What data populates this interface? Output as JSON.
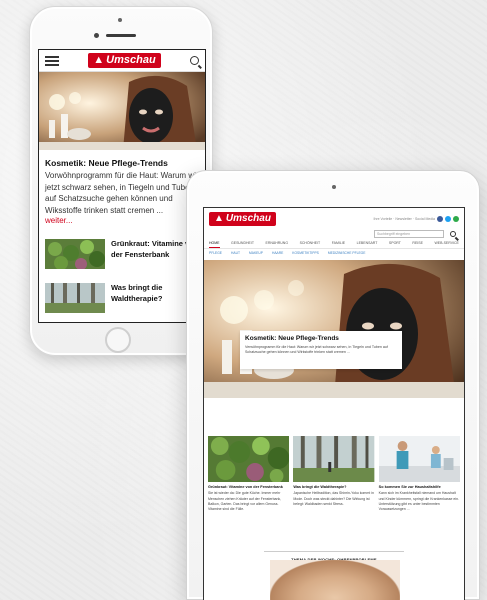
{
  "brand": {
    "name": "Umschau",
    "accent": "#d0021b"
  },
  "phone": {
    "article_title": "Kosmetik: Neue Pflege-Trends",
    "article_teaser": "Vorwöhnprogramm für die Haut: Warum wir jetzt schwarz sehen, in Tiegeln und Tuben auf Schatzsuche gehen können und Wiksstoffe trinken statt cremen ...",
    "more_label": "weiter...",
    "list_items": [
      {
        "title": "Grünkraut: Vitamine von der Fensterbank"
      },
      {
        "title": "Was bringt die Waldtherapie?"
      }
    ]
  },
  "tablet": {
    "top_links": "Ihre Vorteile · Newsletter · Social Media",
    "search_placeholder": "Suchbegriff eingeben",
    "nav": [
      "HOME",
      "GESUNDHEIT",
      "ERNÄHRUNG",
      "SCHÖNHEIT",
      "FAMILIE",
      "LEBENSART",
      "SPORT",
      "REISE",
      "WEB-SERVICE"
    ],
    "subnav": [
      "PFLEGE",
      "HAUT",
      "MAKEUP",
      "HAARE",
      "KOSMETIKTIPPS",
      "MEDIZINISCHE PFLEGE"
    ],
    "hero": {
      "title": "Kosmetik: Neue Pflege-Trends",
      "text": "Verwöhnprogramm für die Haut: Warum wir jetzt schwarz sehen, in Tiegeln und Tuben auf Schatzsuche gehen können und Wirkstoffe trinken statt cremen ..."
    },
    "cards": [
      {
        "title": "Grünkraut: Vitamine von der Fensterbank",
        "text": "Sie ist wieder da: Die gute Küche. Immer mehr Menschen ziehen Kräuter auf der Fensterbank, Balkon, Garten. Das bringt vor allem Genuss. Vitamine sind die Fülle."
      },
      {
        "title": "Was bringt die Waldtherapie?",
        "text": "Japanische Heiltradition, das Shinrin-Yoku kommt in Mode. Doch was steckt dahinter? Die Wirkung ist belegt: Waldbaden senkt Stress."
      },
      {
        "title": "So kommen Sie zur Haushaltshilfe",
        "text": "Kann sich im Krankheitsfall niemand um Haushalt und Kinder kümmern, springt die Krankenkasse ein. Unterstützung gibt es unter bestimmten Voraussetzungen ..."
      }
    ],
    "theme_label": "THEMA DER WOCHE: OHRENPROBLEME"
  },
  "colors": {
    "link": "#3a7fc1",
    "social": [
      "#3b5998",
      "#1da1f2",
      "#2eaa4a"
    ]
  }
}
